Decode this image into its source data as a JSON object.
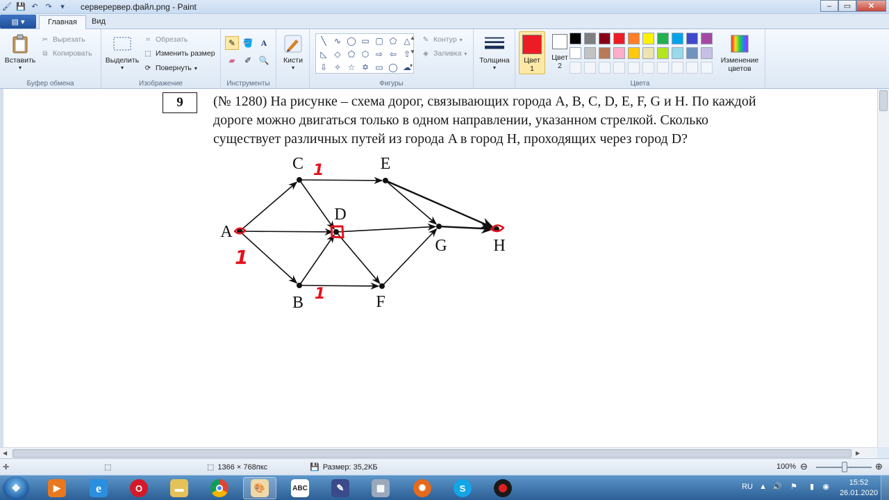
{
  "window": {
    "title": "серверервер.файл.png - Paint"
  },
  "tabs": {
    "home": "Главная",
    "view": "Вид"
  },
  "ribbon": {
    "clipboard": {
      "paste": "Вставить",
      "cut": "Вырезать",
      "copy": "Копировать",
      "label": "Буфер обмена"
    },
    "image": {
      "select": "Выделить",
      "crop": "Обрезать",
      "resize": "Изменить размер",
      "rotate": "Повернуть",
      "label": "Изображение"
    },
    "tools": {
      "label": "Инструменты"
    },
    "brushes": {
      "label": "Кисти"
    },
    "shapes": {
      "outline": "Контур",
      "fill": "Заливка",
      "label": "Фигуры"
    },
    "size": {
      "label": "Толщина"
    },
    "colors": {
      "color1_line1": "Цвет",
      "color1_line2": "1",
      "color2_line1": "Цвет",
      "color2_line2": "2",
      "edit_line1": "Изменение",
      "edit_line2": "цветов",
      "label": "Цвета",
      "color1": "#ed1c24",
      "color2": "#ffffff",
      "palette_row1": [
        "#000000",
        "#7f7f7f",
        "#880015",
        "#ed1c24",
        "#ff7f27",
        "#fff200",
        "#22b14c",
        "#00a2e8",
        "#3f48cc",
        "#a349a4"
      ],
      "palette_row2": [
        "#ffffff",
        "#c3c3c3",
        "#b97a57",
        "#ffaec9",
        "#ffc90e",
        "#efe4b0",
        "#b5e61d",
        "#99d9ea",
        "#7092be",
        "#c8bfe7"
      ]
    }
  },
  "document": {
    "problem_number": "9",
    "problem_text_line1": "(№ 1280) На рисунке – схема дорог, связывающих города A, B, C, D, E, F, G и H. По каждой",
    "problem_text_line2": "дороге можно двигаться только в одном направлении, указанном стрелкой. Сколько",
    "problem_text_line3": "существует различных путей из города A в город H, проходящих через город D?",
    "graph": {
      "nodes": [
        "A",
        "B",
        "C",
        "D",
        "E",
        "F",
        "G",
        "H"
      ],
      "edges": [
        [
          "A",
          "C"
        ],
        [
          "A",
          "D"
        ],
        [
          "A",
          "B"
        ],
        [
          "C",
          "E"
        ],
        [
          "C",
          "D"
        ],
        [
          "B",
          "D"
        ],
        [
          "B",
          "F"
        ],
        [
          "D",
          "G"
        ],
        [
          "D",
          "F"
        ],
        [
          "F",
          "G"
        ],
        [
          "E",
          "G"
        ],
        [
          "E",
          "H"
        ],
        [
          "G",
          "H"
        ]
      ],
      "annotations": {
        "A": "1",
        "C": "1",
        "B": "1"
      },
      "annotation_color": "#e3131c"
    }
  },
  "statusbar": {
    "dimensions": "1366 × 768пкс",
    "size": "Размер: 35,2КБ",
    "zoom": "100%"
  },
  "taskbar": {
    "language": "RU",
    "time": "15:52",
    "date": "26.01.2020"
  }
}
